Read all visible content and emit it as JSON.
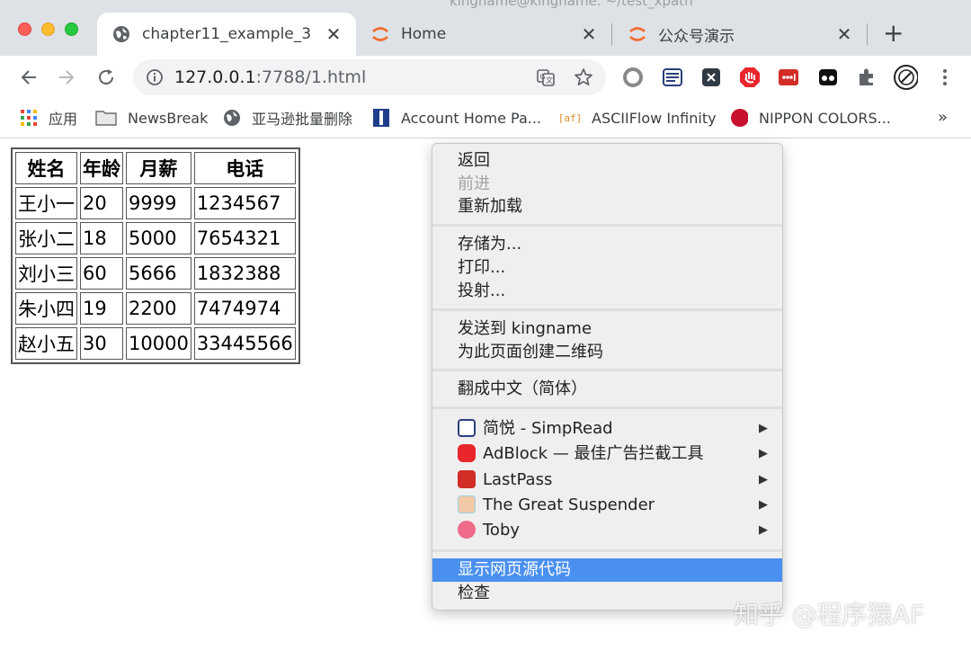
{
  "window": {
    "title": "kingname@kingname: ~/test_xpath"
  },
  "tabs": [
    {
      "title": "chapter11_example_3",
      "active": true
    },
    {
      "title": "Home",
      "active": false
    },
    {
      "title": "公众号演示",
      "active": false
    }
  ],
  "tab_close_glyph": "✕",
  "new_tab_glyph": "+",
  "address": {
    "host": "127.0.0.1",
    "path": ":7788/1.html"
  },
  "bookmarks": [
    {
      "label": "应用",
      "icon": "apps-grid-icon"
    },
    {
      "label": "NewsBreak",
      "icon": "folder-icon"
    },
    {
      "label": "亚马逊批量删除",
      "icon": "globe-icon"
    },
    {
      "label": "Account Home Pa...",
      "icon": "account-page-icon"
    },
    {
      "label": "ASCIIFlow Infinity",
      "icon": "asciiflow-icon"
    },
    {
      "label": "NIPPON COLORS...",
      "icon": "red-circle-icon"
    }
  ],
  "bookmarks_more": "»",
  "table": {
    "headers": [
      "姓名",
      "年龄",
      "月薪",
      "电话"
    ],
    "rows": [
      [
        "王小一",
        "20",
        "9999",
        "1234567"
      ],
      [
        "张小二",
        "18",
        "5000",
        "7654321"
      ],
      [
        "刘小三",
        "60",
        "5666",
        "1832388"
      ],
      [
        "朱小四",
        "19",
        "2200",
        "7474974"
      ],
      [
        "赵小五",
        "30",
        "10000",
        "33445566"
      ]
    ]
  },
  "context_menu": {
    "back": "返回",
    "forward": "前进",
    "reload": "重新加载",
    "save_as": "存储为...",
    "print": "打印...",
    "cast": "投射...",
    "send_to": "发送到 kingname",
    "qr": "为此页面创建二维码",
    "translate": "翻成中文（简体）",
    "ext_simpread": "简悦 - SimpRead",
    "ext_adblock": "AdBlock — 最佳广告拦截工具",
    "ext_lastpass": "LastPass",
    "ext_suspender": "The Great Suspender",
    "ext_toby": "Toby",
    "view_source": "显示网页源代码",
    "inspect": "检查",
    "submenu_arrow": "▶"
  },
  "watermark": "知乎 @程序猿AF",
  "colors": {
    "tabstrip_bg": "#dee1e6",
    "menu_highlight": "#4a90f0",
    "chrome_accent": "#f26b2f"
  }
}
